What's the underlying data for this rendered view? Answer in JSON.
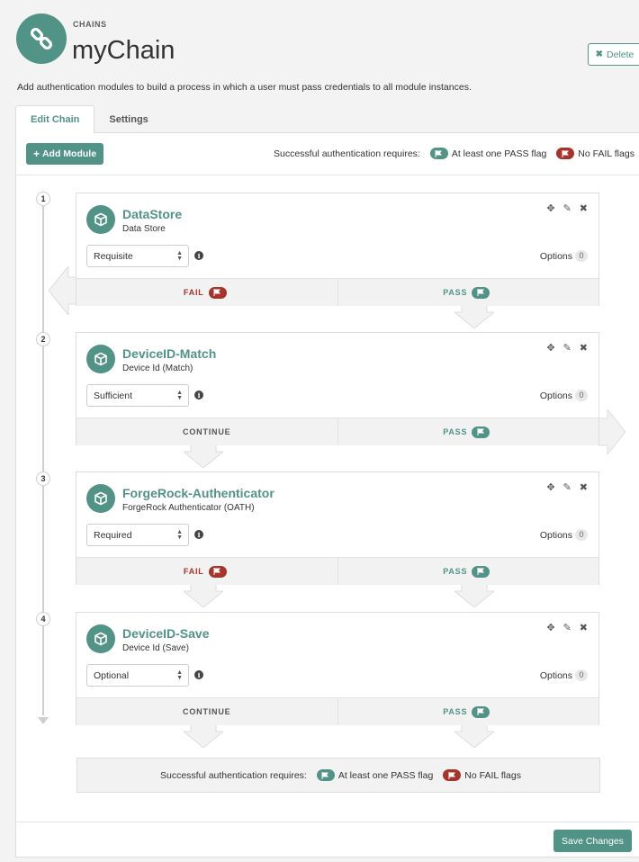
{
  "header": {
    "kicker": "CHAINS",
    "title": "myChain",
    "delete_label": "Delete",
    "intro": "Add authentication modules to build a process in which a user must pass credentials to all module instances."
  },
  "tabs": [
    {
      "label": "Edit Chain",
      "active": true
    },
    {
      "label": "Settings",
      "active": false
    }
  ],
  "toolbar": {
    "add_module_label": "Add Module",
    "requires_label": "Successful authentication requires:",
    "pass_flag_label": "At least one PASS flag",
    "fail_flag_label": "No FAIL flags"
  },
  "modules": [
    {
      "step": "1",
      "name": "DataStore",
      "type": "Data Store",
      "criteria": "Requisite",
      "options_label": "Options",
      "options_count": "0",
      "left_label": "FAIL",
      "right_label": "PASS"
    },
    {
      "step": "2",
      "name": "DeviceID-Match",
      "type": "Device Id (Match)",
      "criteria": "Sufficient",
      "options_label": "Options",
      "options_count": "0",
      "left_label": "CONTINUE",
      "right_label": "PASS"
    },
    {
      "step": "3",
      "name": "ForgeRock-Authenticator",
      "type": "ForgeRock Authenticator (OATH)",
      "criteria": "Required",
      "options_label": "Options",
      "options_count": "0",
      "left_label": "FAIL",
      "right_label": "PASS"
    },
    {
      "step": "4",
      "name": "DeviceID-Save",
      "type": "Device Id (Save)",
      "criteria": "Optional",
      "options_label": "Options",
      "options_count": "0",
      "left_label": "CONTINUE",
      "right_label": "PASS"
    }
  ],
  "footer": {
    "requires_label": "Successful authentication requires:",
    "pass_flag_label": "At least one PASS flag",
    "fail_flag_label": "No FAIL flags",
    "save_label": "Save Changes"
  },
  "colors": {
    "accent": "#519387",
    "fail": "#a6342b"
  }
}
